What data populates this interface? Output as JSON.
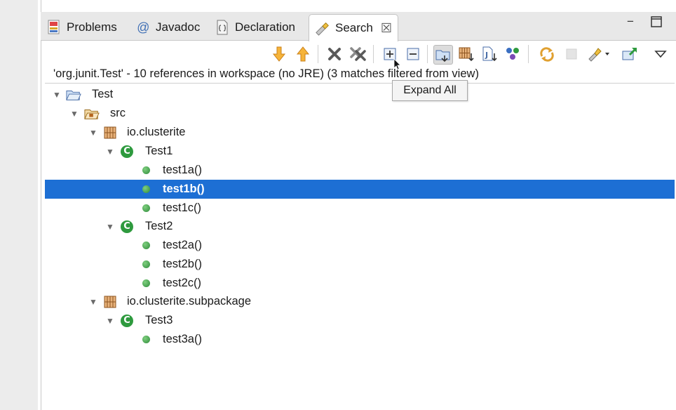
{
  "tabs": [
    {
      "label": "Problems",
      "icon": "problems-icon"
    },
    {
      "label": "Javadoc",
      "icon": "at-sign-icon"
    },
    {
      "label": "Declaration",
      "icon": "declaration-icon"
    },
    {
      "label": "Search",
      "icon": "search-flashlight-icon",
      "active": true
    }
  ],
  "window_controls": {
    "minimize": "−",
    "maximize": "□"
  },
  "close_glyph": "☒",
  "toolbar": {
    "buttons": [
      {
        "name": "next-match-button",
        "icon": "arrow-down-icon"
      },
      {
        "name": "previous-match-button",
        "icon": "arrow-up-icon"
      },
      {
        "name": "remove-selected-matches-button",
        "icon": "remove-x-icon"
      },
      {
        "name": "remove-all-matches-button",
        "icon": "remove-all-icon"
      },
      {
        "name": "expand-all-button",
        "icon": "expand-all-icon"
      },
      {
        "name": "collapse-all-button",
        "icon": "collapse-all-icon"
      },
      {
        "name": "group-by-project-button",
        "icon": "group-by-project-icon"
      },
      {
        "name": "group-by-package-button",
        "icon": "group-by-package-icon"
      },
      {
        "name": "group-by-file-button",
        "icon": "group-by-file-icon"
      },
      {
        "name": "group-by-type-button",
        "icon": "group-by-type-icon"
      },
      {
        "name": "refresh-search-button",
        "icon": "refresh-icon"
      },
      {
        "name": "cancel-search-button",
        "icon": "stop-icon"
      },
      {
        "name": "search-history-button",
        "icon": "history-icon"
      },
      {
        "name": "pin-search-view-button",
        "icon": "pin-icon"
      },
      {
        "name": "view-menu-button",
        "icon": "view-menu-icon"
      }
    ]
  },
  "status_text": "'org.junit.Test' - 10 references in workspace (no JRE) (3 matches filtered from view)",
  "tooltip": "Expand All",
  "tree": [
    {
      "label": "Test",
      "type": "project",
      "depth": 0,
      "expanded": true
    },
    {
      "label": "src",
      "type": "folder",
      "depth": 1,
      "expanded": true
    },
    {
      "label": "io.clusterite",
      "type": "package",
      "depth": 2,
      "expanded": true
    },
    {
      "label": "Test1",
      "type": "class",
      "depth": 3,
      "expanded": true
    },
    {
      "label": "test1a()",
      "type": "method",
      "depth": 4
    },
    {
      "label": "test1b()",
      "type": "method",
      "depth": 4,
      "selected": true
    },
    {
      "label": "test1c()",
      "type": "method",
      "depth": 4
    },
    {
      "label": "Test2",
      "type": "class",
      "depth": 3,
      "expanded": true
    },
    {
      "label": "test2a()",
      "type": "method",
      "depth": 4
    },
    {
      "label": "test2b()",
      "type": "method",
      "depth": 4
    },
    {
      "label": "test2c()",
      "type": "method",
      "depth": 4
    },
    {
      "label": "io.clusterite.subpackage",
      "type": "package",
      "depth": 2,
      "expanded": true
    },
    {
      "label": "Test3",
      "type": "class",
      "depth": 3,
      "expanded": true
    },
    {
      "label": "test3a()",
      "type": "method",
      "depth": 4
    }
  ],
  "colors": {
    "selection": "#1d6fd4",
    "method_dot": "#2e8b3a",
    "class_icon": "#2e9a3e",
    "package_icon": "#b5651d",
    "arrows": "#f0a22e"
  }
}
